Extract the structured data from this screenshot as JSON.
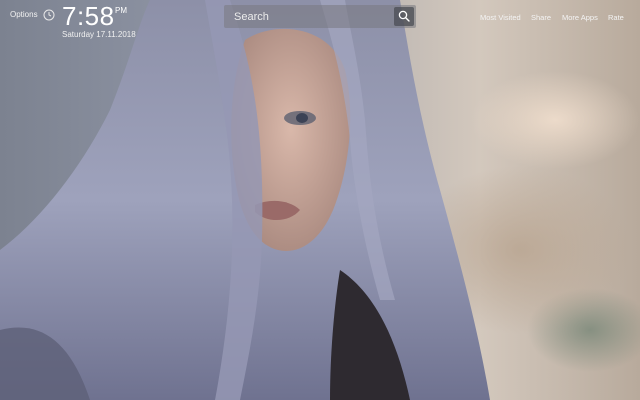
{
  "header": {
    "options_label": "Options",
    "time": "7:58",
    "ampm": "PM",
    "date": "Saturday  17.11.2018"
  },
  "search": {
    "placeholder": "Search"
  },
  "nav": {
    "most_visited": "Most Visited",
    "share": "Share",
    "more_apps": "More Apps",
    "rate": "Rate"
  },
  "icons": {
    "clock": "clock-icon",
    "search": "search-icon"
  },
  "colors": {
    "search_bg": "#77787f",
    "search_button_bg": "#46485a"
  }
}
